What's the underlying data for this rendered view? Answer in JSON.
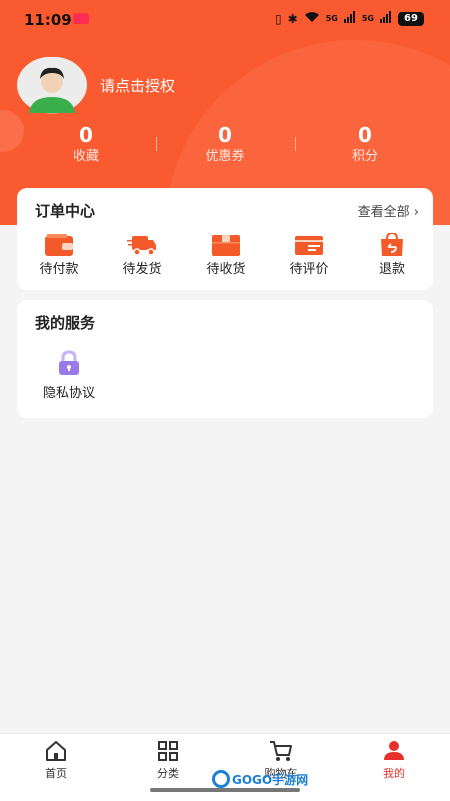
{
  "status_bar": {
    "time": "11:09",
    "network_1": "5G",
    "network_2": "5G",
    "battery": "69"
  },
  "header": {
    "login_prompt": "请点击授权",
    "stats": [
      {
        "value": "0",
        "label": "收藏"
      },
      {
        "value": "0",
        "label": "优惠券"
      },
      {
        "value": "0",
        "label": "积分"
      }
    ],
    "colors": {
      "accent": "#fa5a30"
    }
  },
  "orders": {
    "title": "订单中心",
    "view_all": "查看全部",
    "items": [
      {
        "label": "待付款",
        "icon": "wallet-icon"
      },
      {
        "label": "待发货",
        "icon": "delivery-truck-icon"
      },
      {
        "label": "待收货",
        "icon": "package-box-icon"
      },
      {
        "label": "待评价",
        "icon": "review-card-icon"
      },
      {
        "label": "退款",
        "icon": "refund-bag-icon"
      }
    ]
  },
  "services": {
    "title": "我的服务",
    "items": [
      {
        "label": "隐私协议",
        "icon": "lock-icon"
      }
    ]
  },
  "tabbar": {
    "items": [
      {
        "label": "首页",
        "icon": "home-icon"
      },
      {
        "label": "分类",
        "icon": "grid-icon"
      },
      {
        "label": "购物车",
        "icon": "cart-icon"
      },
      {
        "label": "我的",
        "icon": "user-icon",
        "active": true
      }
    ],
    "colors": {
      "active": "#e5302b"
    }
  },
  "watermark": "GOGO手游网"
}
